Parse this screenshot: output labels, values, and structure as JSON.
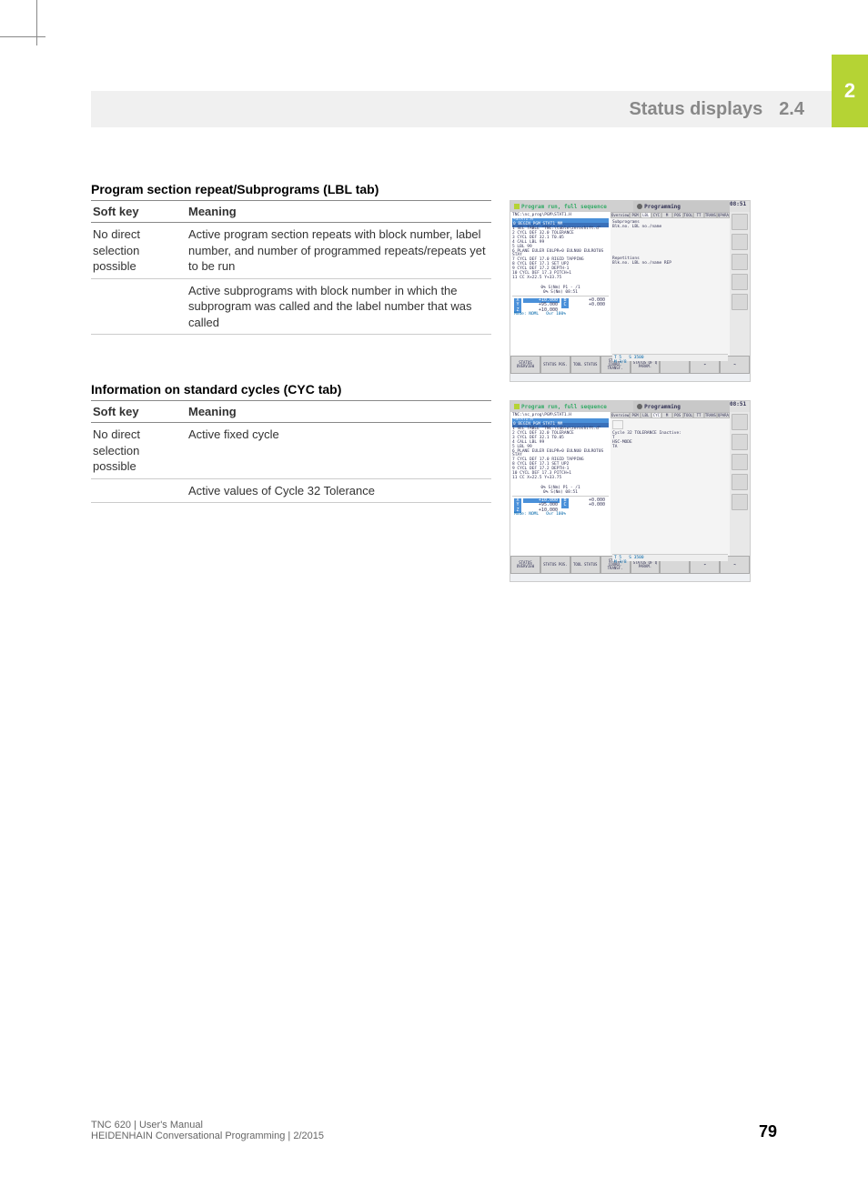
{
  "page": {
    "chapter_tab": "2",
    "header_title": "Status displays",
    "header_number": "2.4",
    "page_number": "79"
  },
  "footer": {
    "line1": "TNC 620 | User's Manual",
    "line2": "HEIDENHAIN Conversational Programming | 2/2015"
  },
  "section1": {
    "title": "Program section repeat/Subprograms (LBL tab)",
    "col1": "Soft key",
    "col2": "Meaning",
    "rows": [
      {
        "sk": "No direct selection possible",
        "mn": "Active program section repeats with block number, label number, and number of programmed repeats/repeats yet to be run"
      },
      {
        "sk": "",
        "mn": "Active subprograms with block number in which the subprogram was called and the label number that was called"
      }
    ]
  },
  "section2": {
    "title": "Information on standard cycles (CYC tab)",
    "col1": "Soft key",
    "col2": "Meaning",
    "rows": [
      {
        "sk": "No direct selection possible",
        "mn": "Active fixed cycle"
      },
      {
        "sk": "",
        "mn": "Active values of Cycle 32 Tolerance"
      }
    ]
  },
  "screenshot_common": {
    "title_left": "Program run, full sequence",
    "title_right": "Programming",
    "subtitle": "Program run full sequence",
    "prog_path": "TNC:\\nc_prog\\PGM\\STAT1.H",
    "prog_file": "→STAT1.H",
    "prog_hl": "0  BEGIN PGM STAT1 MM",
    "prog_lines": [
      "1  SEL TABLE \"TNC:\\table\\zeroshift.d\"",
      "2  CYCL DEF 32.0 TOLERANCE",
      "3  CYCL DEF 32.1 T0.05",
      "4  CALL LBL 99",
      "5  LBL 99",
      "6  PLANE EULER EULPR+0 EULNU0 EULROT0S",
      "   STAY",
      "7  CYCL DEF 17.0 RIGID TAPPING",
      "8  CYCL DEF 17.1 SET UP2",
      "9  CYCL DEF 17.2 DEPTH-1",
      "10 CYCL DEF 17.3 PITCH+1",
      "11 CC  X+22.5  Y+33.75"
    ],
    "view1": "0% S(Nm) P1 - /1",
    "view2": "0% S(Nm) 08:51",
    "coords": {
      "x": {
        "label": "X",
        "val": "+10.000",
        "b": {
          "label": "B",
          "val": "+0.000"
        }
      },
      "y": {
        "label": "Y",
        "val": "+95.000",
        "c": {
          "label": "C",
          "val": "+0.000"
        }
      },
      "z": {
        "label": "Z",
        "val": "+10.000"
      }
    },
    "mode": "Mode: NOML",
    "override": "Ovr 100%",
    "status_t": "T 5",
    "status_s": "S 3500",
    "status_m": "M 3/8",
    "softkeys": [
      "STATUS OVERVIEW",
      "STATUS POS.",
      "TOOL STATUS",
      "STATUS COORD. TRANSF.",
      "STATUS OF Q PARAM."
    ],
    "tabs": [
      "Overview",
      "PGM",
      "LBL",
      "CYC",
      "M",
      "POS",
      "TOOL",
      "TT",
      "TRANS",
      "QPARA"
    ]
  },
  "screenshot1": {
    "active_tab": "LBL",
    "info_h1": "Subprograms",
    "info_l1": "Blk.no. LBL no./name",
    "info_h2": "Repetitions",
    "info_l2": "Blk.no. LBL no./name    REP"
  },
  "screenshot2": {
    "active_tab": "CYC",
    "info_h1": "Cycle 32 TOLERANCE Inactive:",
    "info_l1": "T",
    "info_l2": "HSC-MODE",
    "info_l3": "TA"
  }
}
